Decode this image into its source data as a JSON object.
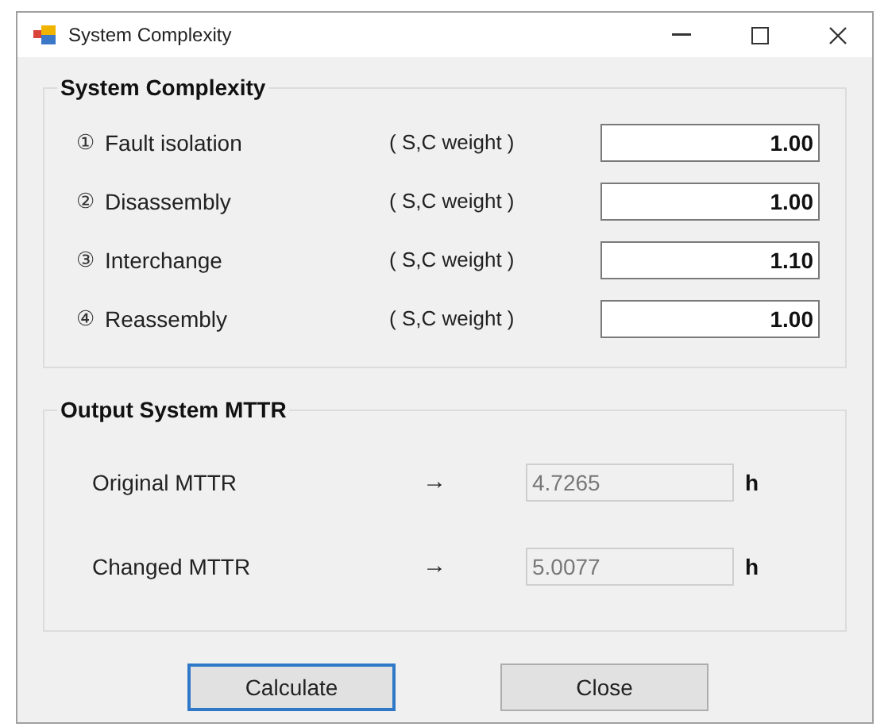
{
  "window": {
    "title": "System Complexity"
  },
  "complexity_group": {
    "title": "System Complexity",
    "rows": [
      {
        "number": "①",
        "label": "Fault isolation",
        "unit": "( S,C weight )",
        "value": "1.00"
      },
      {
        "number": "②",
        "label": "Disassembly",
        "unit": "( S,C weight )",
        "value": "1.00"
      },
      {
        "number": "③",
        "label": "Interchange",
        "unit": "( S,C weight )",
        "value": "1.10"
      },
      {
        "number": "④",
        "label": "Reassembly",
        "unit": "( S,C weight )",
        "value": "1.00"
      }
    ]
  },
  "output_group": {
    "title": "Output System MTTR",
    "rows": [
      {
        "label": "Original MTTR",
        "arrow": "→",
        "value": "4.7265",
        "disabled": true,
        "unit": "h"
      },
      {
        "label": "Changed MTTR",
        "arrow": "→",
        "value": "5.0077",
        "disabled": true,
        "unit": "h"
      }
    ]
  },
  "buttons": [
    {
      "label": "Calculate",
      "focused": true
    },
    {
      "label": "Close",
      "focused": false
    }
  ]
}
